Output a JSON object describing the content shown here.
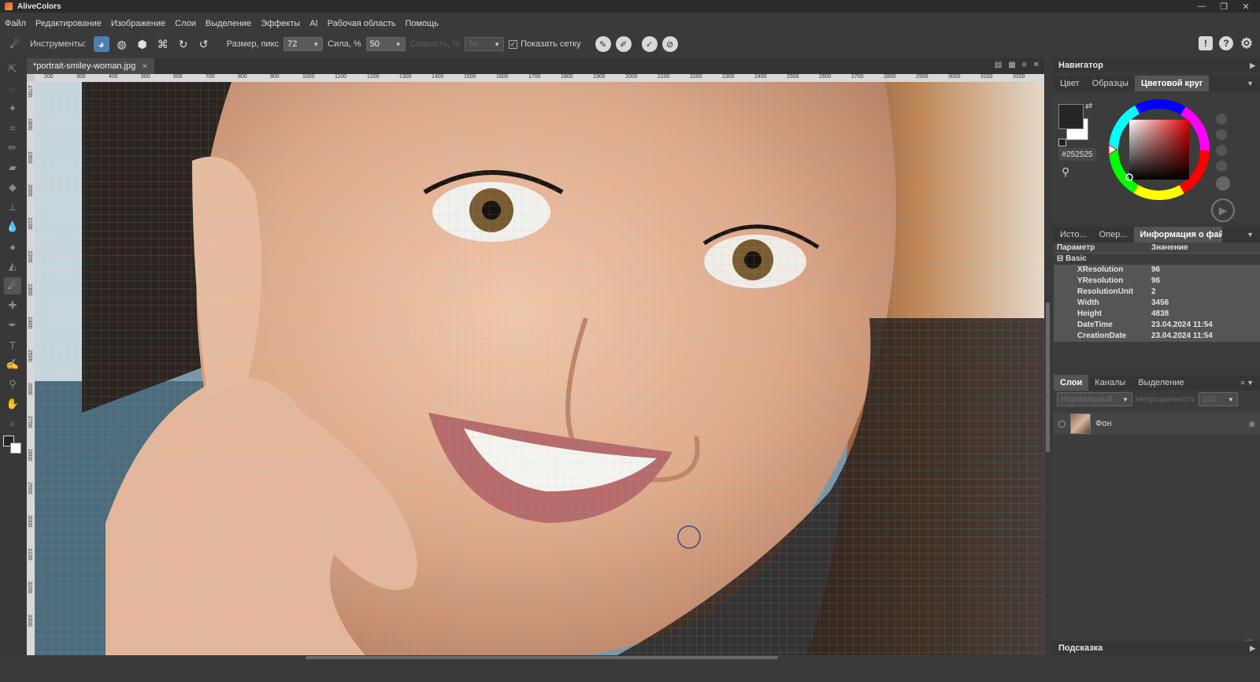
{
  "app": {
    "title": "AliveColors"
  },
  "window_controls": {
    "minimize": "—",
    "maximize": "❐",
    "close": "✕"
  },
  "menu": [
    "Файл",
    "Редактирование",
    "Изображение",
    "Слои",
    "Выделение",
    "Эффекты",
    "AI",
    "Рабочая область",
    "Помощь"
  ],
  "toolbar": {
    "tools_label": "Инструменты:",
    "size_label": "Размер, пикс",
    "size_value": "72",
    "strength_label": "Сила, %",
    "strength_value": "50",
    "speed_label": "Скорость, %",
    "speed_value": "50",
    "show_grid_label": "Показать сетку",
    "show_grid_checked": "✓"
  },
  "document": {
    "tab_title": "*portrait-smiley-woman.jpg"
  },
  "ruler": {
    "h_ticks": [
      "200",
      "300",
      "400",
      "500",
      "600",
      "700",
      "800",
      "900",
      "1000",
      "1100",
      "1200",
      "1300",
      "1400",
      "1500",
      "1600",
      "1700",
      "1800",
      "1900",
      "2000",
      "2100",
      "2200",
      "2300",
      "2400",
      "2500",
      "2600",
      "2700",
      "2800",
      "2900",
      "3000",
      "3100",
      "3200"
    ],
    "v_ticks": [
      "1700",
      "1800",
      "1900",
      "2000",
      "2100",
      "2200",
      "2300",
      "2400",
      "2500",
      "2600",
      "2700",
      "2800",
      "2900",
      "3000",
      "3100",
      "3200",
      "3300"
    ]
  },
  "navigator": {
    "title": "Навигатор"
  },
  "color_panel": {
    "tabs": [
      "Цвет",
      "Образцы",
      "Цветовой круг"
    ],
    "active_tab": "Цветовой круг",
    "hex": "#252525",
    "foreground_color": "#252525",
    "background_color": "#ffffff"
  },
  "info_panel": {
    "tabs": [
      "Исто...",
      "Опер...",
      "Информация о файл"
    ],
    "col_param": "Параметр",
    "col_value": "Значение",
    "group": "Basic",
    "rows": [
      {
        "param": "XResolution",
        "value": "96"
      },
      {
        "param": "YResolution",
        "value": "96"
      },
      {
        "param": "ResolutionUnit",
        "value": "2"
      },
      {
        "param": "Width",
        "value": "3456"
      },
      {
        "param": "Height",
        "value": "4838"
      },
      {
        "param": "DateTime",
        "value": "23.04.2024 11:54"
      },
      {
        "param": "CreationDate",
        "value": "23.04.2024 11:54"
      }
    ]
  },
  "layers_panel": {
    "tabs": [
      "Слои",
      "Каналы",
      "Выделение"
    ],
    "blend_mode": "Нормальный",
    "opacity_label": "Непрозрачность",
    "opacity_value": "100",
    "layers": [
      {
        "name": "Фон"
      }
    ]
  },
  "hint_panel": {
    "title": "Подсказка"
  }
}
